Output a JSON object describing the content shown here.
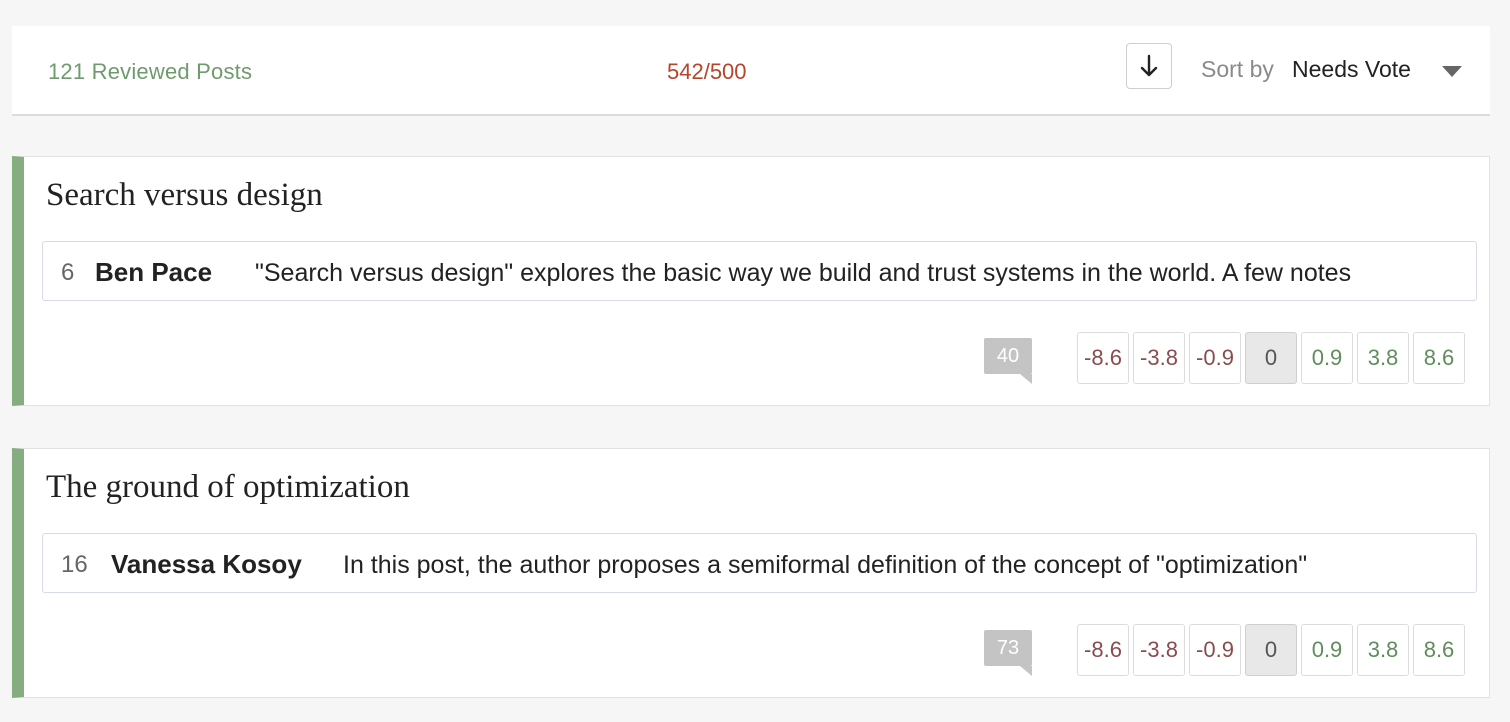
{
  "header": {
    "reviewed_label": "121 Reviewed Posts",
    "budget": "542/500",
    "sort_label": "Sort by",
    "sort_value": "Needs Vote"
  },
  "posts": [
    {
      "title": "Search versus design",
      "review_karma": "6",
      "review_author": "Ben Pace",
      "review_text": "\"Search versus design\" explores the basic way we build and trust systems in the world. A few notes",
      "comment_count": "40",
      "votes": [
        "-8.6",
        "-3.8",
        "-0.9",
        "0",
        "0.9",
        "3.8",
        "8.6"
      ]
    },
    {
      "title": "The ground of optimization",
      "review_karma": "16",
      "review_author": "Vanessa Kosoy",
      "review_text": "In this post, the author proposes a semiformal definition of the concept of \"optimization\"",
      "comment_count": "73",
      "votes": [
        "-8.6",
        "-3.8",
        "-0.9",
        "0",
        "0.9",
        "3.8",
        "8.6"
      ]
    }
  ],
  "colors": {
    "accent_green": "#86ad80",
    "reviewed_green": "#6f9b6c",
    "budget_red": "#b5452c"
  }
}
